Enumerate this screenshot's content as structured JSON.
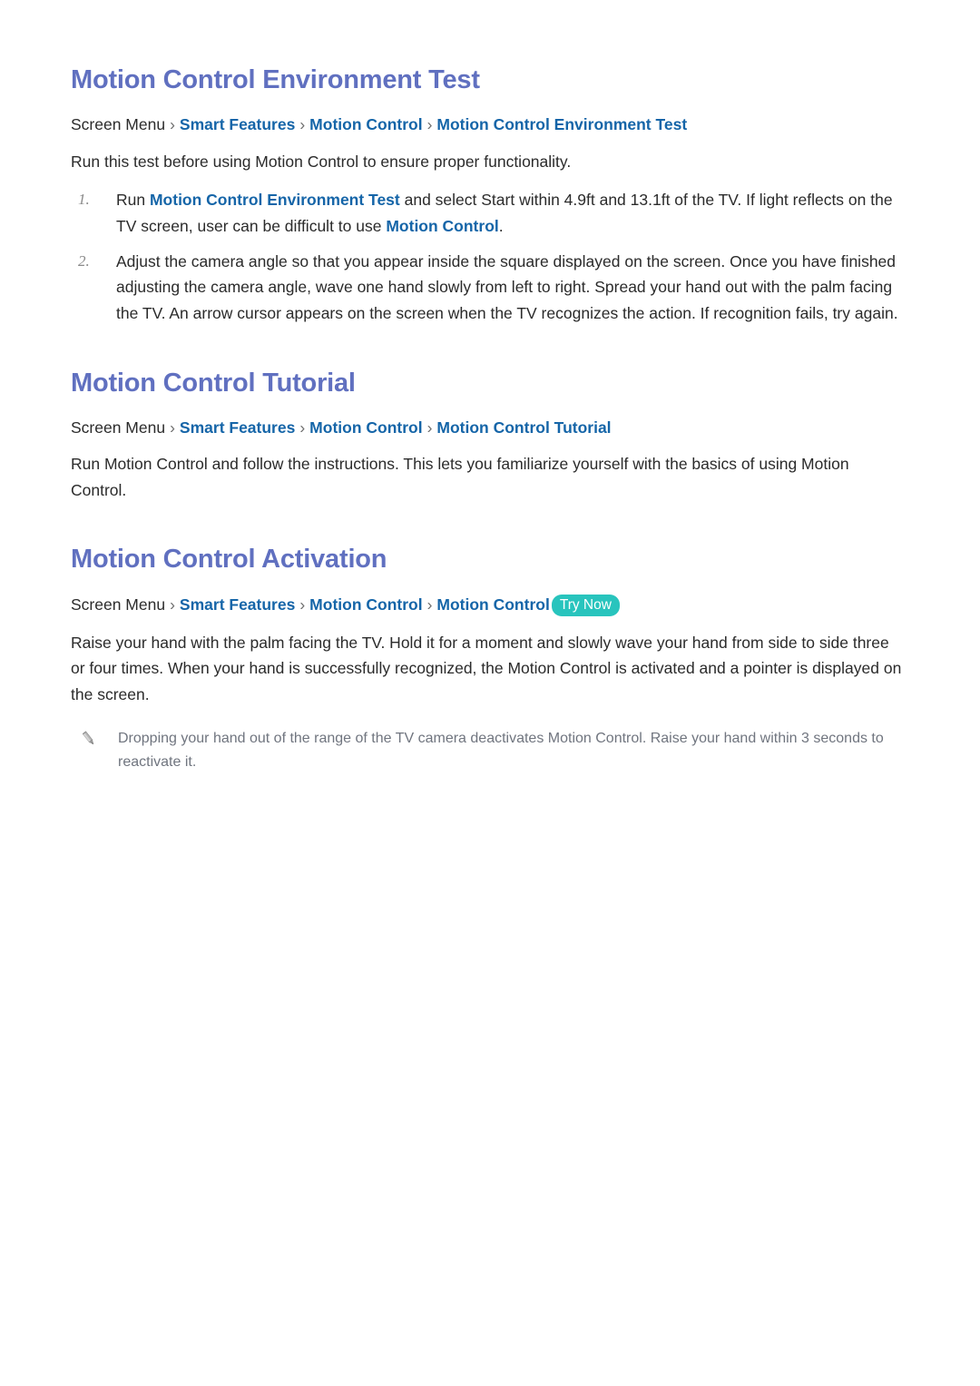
{
  "document": {
    "colors": {
      "heading": "#6070c0",
      "link": "#1565a8",
      "body": "#2b2b2b",
      "note": "#70757f",
      "badge_bg": "#28c4bd",
      "badge_text": "#ffffff",
      "page_bg": "#ffffff"
    },
    "sections": [
      {
        "id": "motion-control-environment-test",
        "title": "Motion Control Environment Test",
        "breadcrumb": {
          "root": "Screen Menu",
          "separator": "›",
          "links": [
            "Smart Features",
            "Motion Control",
            "Motion Control Environment Test"
          ],
          "badge": null
        },
        "intro": "Run this test before using Motion Control to ensure proper functionality.",
        "steps": [
          {
            "number": "1.",
            "parts": [
              {
                "text": "Run ",
                "link": false
              },
              {
                "text": "Motion Control Environment Test",
                "link": true
              },
              {
                "text": " and select Start within 4.9ft and 13.1ft of the TV. If light reflects on the TV screen, user can be difficult to use ",
                "link": false
              },
              {
                "text": "Motion Control",
                "link": true
              },
              {
                "text": ".",
                "link": false
              }
            ]
          },
          {
            "number": "2.",
            "parts": [
              {
                "text": "Adjust the camera angle so that you appear inside the square displayed on the screen. Once you have finished adjusting the camera angle, wave one hand slowly from left to right. Spread your hand out with the palm facing the TV. An arrow cursor appears on the screen when the TV recognizes the action. If recognition fails, try again.",
                "link": false
              }
            ]
          }
        ],
        "note": null
      },
      {
        "id": "motion-control-tutorial",
        "title": "Motion Control Tutorial",
        "breadcrumb": {
          "root": "Screen Menu",
          "separator": "›",
          "links": [
            "Smart Features",
            "Motion Control",
            "Motion Control Tutorial"
          ],
          "badge": null
        },
        "intro": "Run Motion Control and follow the instructions. This lets you familiarize yourself with the basics of using Motion Control.",
        "steps": [],
        "note": null
      },
      {
        "id": "motion-control-activation",
        "title": "Motion Control Activation",
        "breadcrumb": {
          "root": "Screen Menu",
          "separator": "›",
          "links": [
            "Smart Features",
            "Motion Control",
            "Motion Control"
          ],
          "badge": "Try Now"
        },
        "intro": "Raise your hand with the palm facing the TV. Hold it for a moment and slowly wave your hand from side to side three or four times. When your hand is successfully recognized, the Motion Control is activated and a pointer is displayed on the screen.",
        "steps": [],
        "note": {
          "icon": "pencil-icon",
          "text": "Dropping your hand out of the range of the TV camera deactivates Motion Control. Raise your hand within 3 seconds to reactivate it."
        }
      }
    ]
  }
}
